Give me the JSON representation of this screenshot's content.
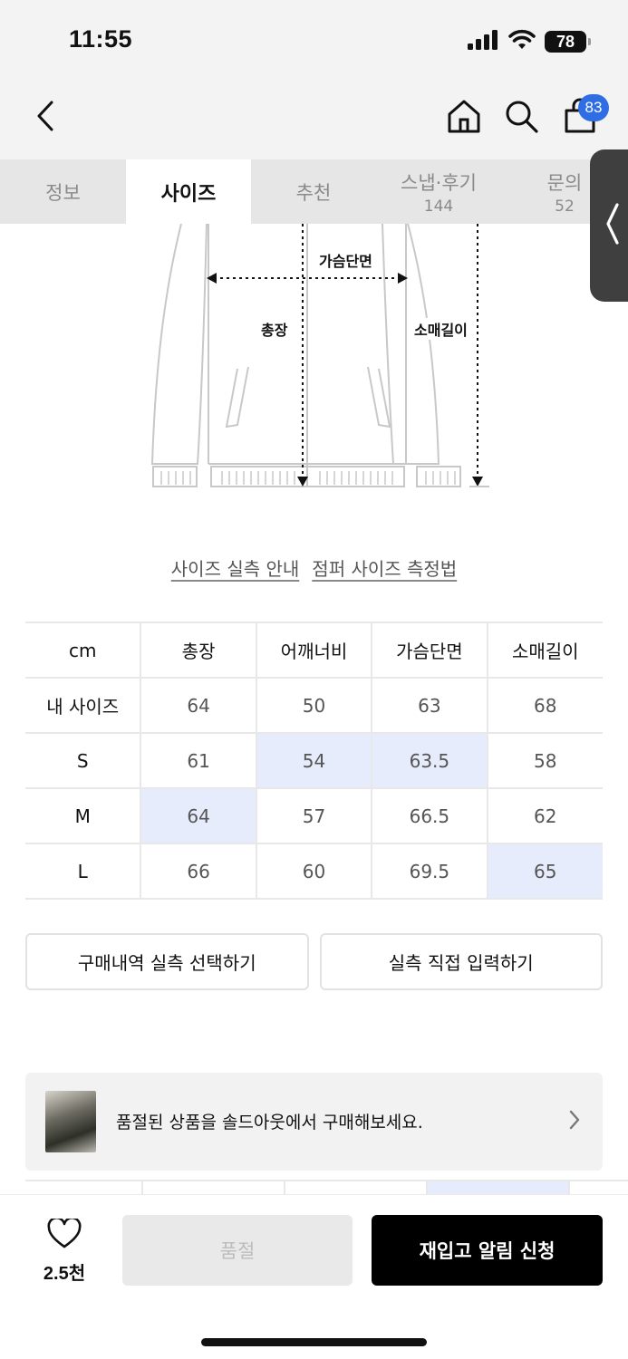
{
  "status": {
    "time": "11:55",
    "battery": "78"
  },
  "header": {
    "cart_count": "83"
  },
  "tabs": [
    {
      "label": "정보",
      "count": ""
    },
    {
      "label": "사이즈",
      "count": ""
    },
    {
      "label": "추천",
      "count": ""
    },
    {
      "label": "스냅·후기",
      "count": "144"
    },
    {
      "label": "문의",
      "count": "52"
    }
  ],
  "diagram": {
    "chest_label": "가슴단면",
    "length_label": "총장",
    "sleeve_label": "소매길이"
  },
  "links": {
    "size_guide": "사이즈 실측 안내",
    "measure_method": "점퍼 사이즈 측정법"
  },
  "size_table": {
    "headers": [
      "cm",
      "총장",
      "어깨너비",
      "가슴단면",
      "소매길이"
    ],
    "rows": [
      [
        "내 사이즈",
        "64",
        "50",
        "63",
        "68"
      ],
      [
        "S",
        "61",
        "54",
        "63.5",
        "58"
      ],
      [
        "M",
        "64",
        "57",
        "66.5",
        "62"
      ],
      [
        "L",
        "66",
        "60",
        "69.5",
        "65"
      ]
    ]
  },
  "actions": {
    "select_purchase": "구매내역 실측 선택하기",
    "direct_input": "실측 직접 입력하기"
  },
  "promo": {
    "text": "품절된 상품을 솔드아웃에서 구매해보세요."
  },
  "bottom": {
    "like_count": "2.5천",
    "soldout_label": "품절",
    "restock_label": "재입고 알림 신청"
  },
  "colors": {
    "accent_badge": "#2f6de5",
    "highlight_cell": "#e7ecfd",
    "primary_button": "#000000"
  },
  "icons": [
    "back-chevron-icon",
    "home-icon",
    "search-icon",
    "cart-icon",
    "heart-icon",
    "chevron-right-icon",
    "signal-icon",
    "wifi-icon"
  ]
}
